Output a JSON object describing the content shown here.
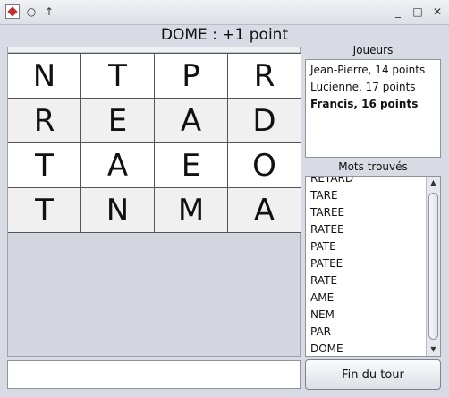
{
  "titlebar": {
    "icons": [
      "app-icon",
      "circle-icon",
      "up-arrow-icon"
    ],
    "controls": [
      "minimize-icon",
      "maximize-icon",
      "close-icon"
    ]
  },
  "status": "DOME : +1 point",
  "board": [
    [
      "N",
      "T",
      "P",
      "R"
    ],
    [
      "R",
      "E",
      "A",
      "D"
    ],
    [
      "T",
      "A",
      "E",
      "O"
    ],
    [
      "T",
      "N",
      "M",
      "A"
    ]
  ],
  "players_title": "Joueurs",
  "players": [
    {
      "label": "Jean-Pierre, 14 points",
      "current": false
    },
    {
      "label": "Lucienne, 17 points",
      "current": false
    },
    {
      "label": "Francis, 16 points",
      "current": true
    }
  ],
  "words_title": "Mots trouvés",
  "words": [
    "RETARD",
    "TARE",
    "TAREE",
    "RATEE",
    "PATE",
    "PATEE",
    "RATE",
    "AME",
    "NEM",
    "PAR",
    "DOME"
  ],
  "input_value": "",
  "end_button": "Fin du tour"
}
